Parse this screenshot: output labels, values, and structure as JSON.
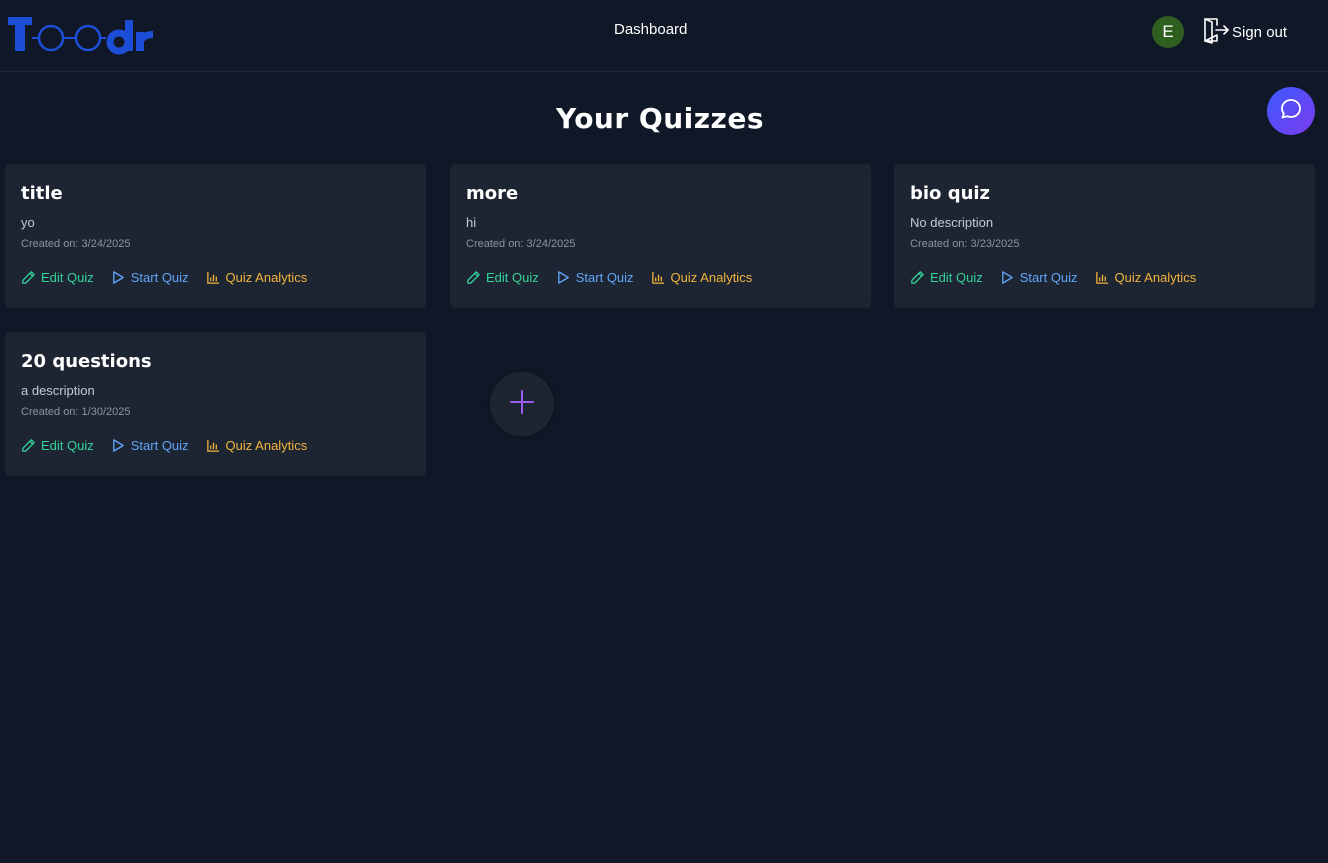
{
  "app": {
    "logo_text": "Toodr",
    "brand_color": "#1d4ed8"
  },
  "nav": {
    "dashboard_label": "Dashboard",
    "avatar_initial": "E",
    "avatar_color": "#2f5f1f",
    "signout_label": "Sign out"
  },
  "main": {
    "title": "Your Quizzes",
    "action_labels": {
      "edit": "Edit Quiz",
      "start": "Start Quiz",
      "analytics": "Quiz Analytics"
    },
    "quizzes": [
      {
        "title": "title",
        "description": "yo",
        "created": "Created on: 3/24/2025"
      },
      {
        "title": "more",
        "description": "hi",
        "created": "Created on: 3/24/2025"
      },
      {
        "title": "bio quiz",
        "description": "No description",
        "created": "Created on: 3/23/2025"
      },
      {
        "title": "20 questions",
        "description": "a description",
        "created": "Created on: 1/30/2025"
      }
    ]
  },
  "colors": {
    "background": "#101827",
    "card": "#1e2532",
    "edit": "#34d399",
    "start": "#60a5fa",
    "analytics": "#f0b43b",
    "add": "#9b5cf6"
  },
  "icons": [
    "pencil-icon",
    "play-icon",
    "bar-chart-icon",
    "signout-icon",
    "chat-icon",
    "plus-icon"
  ]
}
